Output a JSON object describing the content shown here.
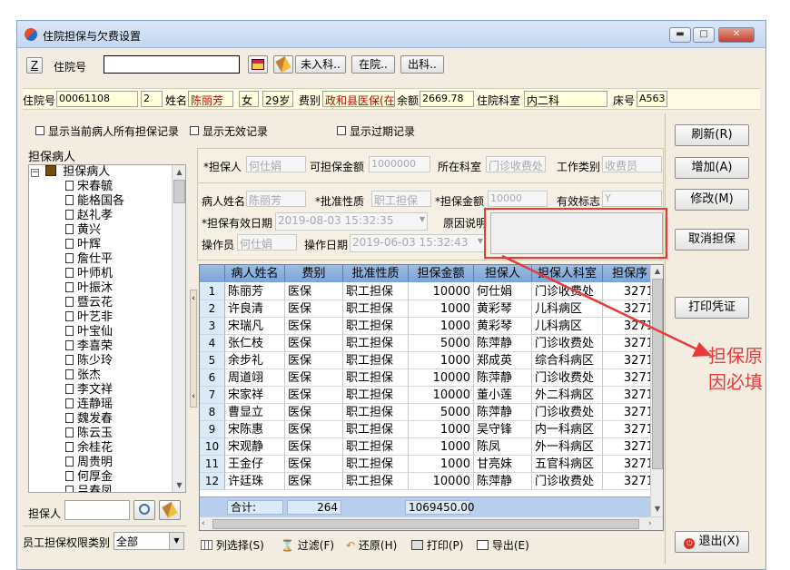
{
  "window": {
    "title": "住院担保与欠费设置",
    "min": "▬",
    "max": "□",
    "close": "✕"
  },
  "search_bar": {
    "z_label": "Z",
    "inpatient_no_label": "住院号",
    "inpatient_no_value": "",
    "btn_not_admitted": "未入科..",
    "btn_in_hospital": "在院..",
    "btn_discharged": "出科.."
  },
  "info_bar": {
    "inpatient_no_label": "住院号",
    "inpatient_no_value": "00061108",
    "times_value": "2",
    "name_label": "姓名",
    "name_value": "陈丽芳",
    "sex_value": "女",
    "age_value": "29岁",
    "fee_type_label": "费别",
    "fee_type_value": "政和县医保(在",
    "balance_label": "余额",
    "balance_value": "2669.78",
    "dept_label": "住院科室",
    "dept_value": "内二科",
    "bed_label": "床号",
    "bed_value": "A563"
  },
  "options": {
    "show_all_for_patient": "显示当前病人所有担保记录",
    "show_invalid": "显示无效记录",
    "show_expired": "显示过期记录"
  },
  "tree": {
    "section_label": "担保病人",
    "root_label": "担保病人",
    "items": [
      "宋春毓",
      "能格国各",
      "赵礼孝",
      "黄兴",
      "叶辉",
      "詹仕平",
      "叶师机",
      "叶振沐",
      "暨云花",
      "叶艺非",
      "叶宝仙",
      "李喜荣",
      "陈少玲",
      "张杰",
      "李文祥",
      "连静瑶",
      "魏发春",
      "陈云玉",
      "余桂花",
      "周贵明",
      "何厚金",
      "吕春凤"
    ]
  },
  "left_bottom": {
    "guarantor_label": "担保人",
    "guarantor_value": "",
    "perm_label": "员工担保权限类别",
    "perm_value": "全部"
  },
  "form": {
    "guarantor_label": "*担保人",
    "guarantor_value": "何仕娟",
    "available_label": "可担保金额",
    "available_value": "1000000",
    "dept_label": "所在科室",
    "dept_value": "门诊收费处",
    "job_label": "工作类别",
    "job_value": "收费员",
    "patient_label": "病人姓名",
    "patient_value": "陈丽芳",
    "nature_label": "*批准性质",
    "nature_value": "职工担保",
    "amount_label": "*担保金额",
    "amount_value": "10000",
    "valid_flag_label": "有效标志",
    "valid_flag_value": "Y",
    "valid_date_label": "*担保有效日期",
    "valid_date_value": "2019-08-03 15:32:35",
    "reason_label": "原因说明",
    "reason_value": "",
    "operator_label": "操作员",
    "operator_value": "何仕娟",
    "op_date_label": "操作日期",
    "op_date_value": "2019-06-03 15:32:43"
  },
  "annotation": {
    "text_line1": "担保原",
    "text_line2": "因必填",
    "color": "#e83a3a"
  },
  "grid": {
    "columns": [
      "病人姓名",
      "费别",
      "批准性质",
      "担保金额",
      "担保人",
      "担保人科室",
      "担保序"
    ],
    "rows": [
      [
        "1",
        "陈丽芳",
        "医保",
        "职工担保",
        "10000",
        "何仕娟",
        "门诊收费处",
        "3271"
      ],
      [
        "2",
        "许良清",
        "医保",
        "职工担保",
        "1000",
        "黄彩琴",
        "儿科病区",
        "3271"
      ],
      [
        "3",
        "宋瑞凡",
        "医保",
        "职工担保",
        "1000",
        "黄彩琴",
        "儿科病区",
        "3271"
      ],
      [
        "4",
        "张仁枝",
        "医保",
        "职工担保",
        "5000",
        "陈萍静",
        "门诊收费处",
        "3271"
      ],
      [
        "5",
        "余步礼",
        "医保",
        "职工担保",
        "1000",
        "郑成英",
        "综合科病区",
        "3271"
      ],
      [
        "6",
        "周道翊",
        "医保",
        "职工担保",
        "10000",
        "陈萍静",
        "门诊收费处",
        "3271"
      ],
      [
        "7",
        "宋家祥",
        "医保",
        "职工担保",
        "10000",
        "董小莲",
        "外二科病区",
        "3271"
      ],
      [
        "8",
        "曹显立",
        "医保",
        "职工担保",
        "5000",
        "陈萍静",
        "门诊收费处",
        "3271"
      ],
      [
        "9",
        "宋陈惠",
        "医保",
        "职工担保",
        "1000",
        "吴守锋",
        "内一科病区",
        "3271"
      ],
      [
        "10",
        "宋观静",
        "医保",
        "职工担保",
        "1000",
        "陈凤",
        "外一科病区",
        "3271"
      ],
      [
        "11",
        "王金仔",
        "医保",
        "职工担保",
        "1000",
        "甘亮妹",
        "五官科病区",
        "3271"
      ],
      [
        "12",
        "许廷珠",
        "医保",
        "职工担保",
        "10000",
        "陈萍静",
        "门诊收费处",
        "3271"
      ]
    ],
    "sum_label": "合计:",
    "sum_count": "264",
    "sum_amount": "1069450.00"
  },
  "side_buttons": {
    "refresh": "刷新(R)",
    "add": "增加(A)",
    "modify": "修改(M)",
    "cancel": "取消担保",
    "print_voucher": "打印凭证",
    "exit": "退出(X)"
  },
  "toolbar": {
    "columns": "列选择(S)",
    "filter": "过滤(F)",
    "restore": "还原(H)",
    "print": "打印(P)",
    "export": "导出(E)"
  }
}
